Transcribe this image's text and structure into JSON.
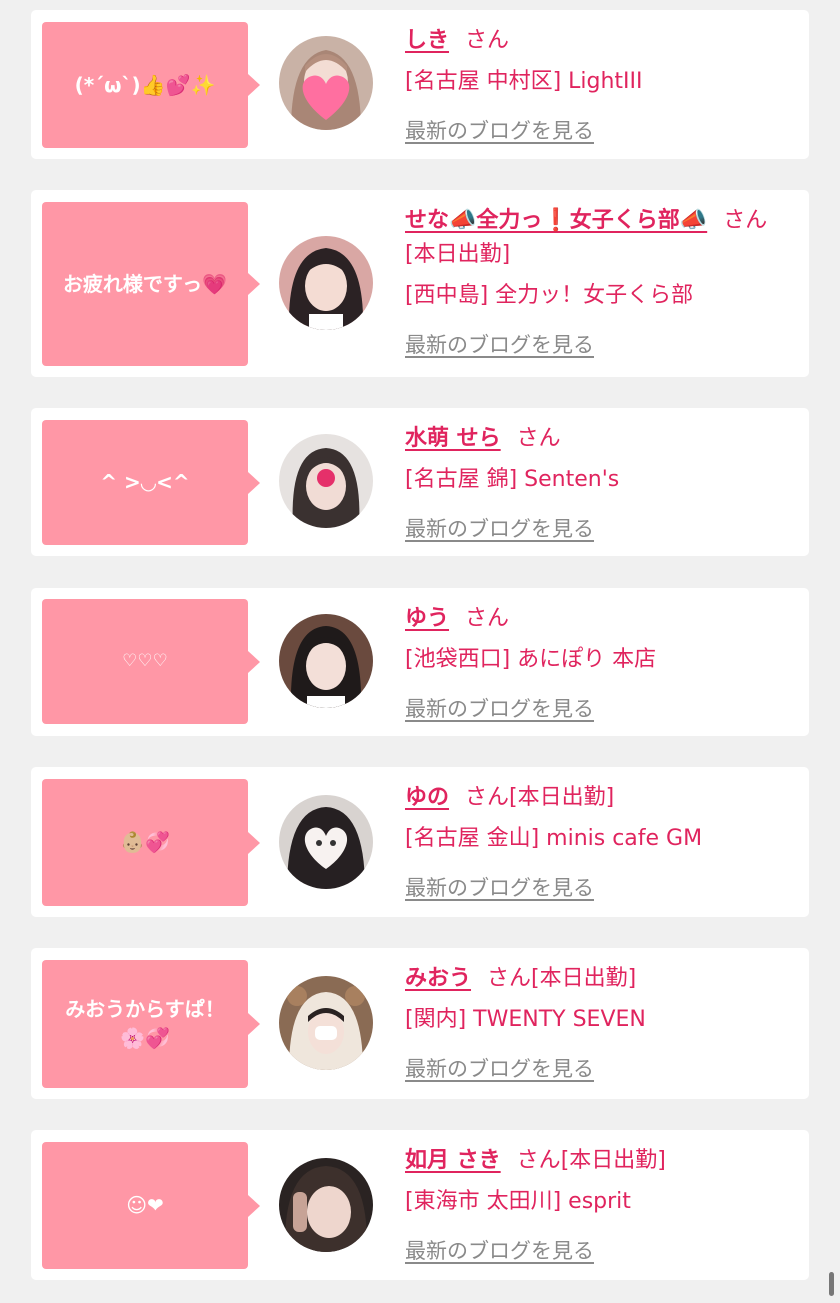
{
  "common": {
    "honorific": "さん",
    "blog_link_label": "最新のブログを見る"
  },
  "colors": {
    "page_bg": "#f0f0f0",
    "card_bg": "#ffffff",
    "bubble_bg": "#ff97a6",
    "name_color": "#e0245e",
    "link_gray": "#8a8a8a"
  },
  "cards": [
    {
      "bubble": "(*´ω`)👍💕✨",
      "name": "しき",
      "suffix": "",
      "shop": "[名古屋 中村区] LightIII"
    },
    {
      "bubble": "お疲れ様ですっ💗",
      "name": "せな📣全力っ❗️女子くら部📣",
      "suffix": "[本日出勤]",
      "shop": "[西中島] 全力ッ！女子くら部"
    },
    {
      "bubble": "^ >◡<^",
      "name": "水萌 せら",
      "suffix": "",
      "shop": "[名古屋 錦] Senten's"
    },
    {
      "bubble": "♡♡♡",
      "name": "ゆう",
      "suffix": "",
      "shop": "[池袋西口] あにぽり 本店"
    },
    {
      "bubble": "👶🏼💞",
      "name": "ゆの",
      "suffix": "[本日出勤]",
      "shop": "[名古屋 金山] minis cafe GM"
    },
    {
      "bubble": "みおうからすぱ！\n🌸💞",
      "name": "みおう",
      "suffix": "[本日出勤]",
      "shop": "[関内] TWENTY SEVEN"
    },
    {
      "bubble": "☺❤",
      "name": "如月 さき",
      "suffix": "[本日出勤]",
      "shop": "[東海市 太田川] esprit"
    }
  ]
}
